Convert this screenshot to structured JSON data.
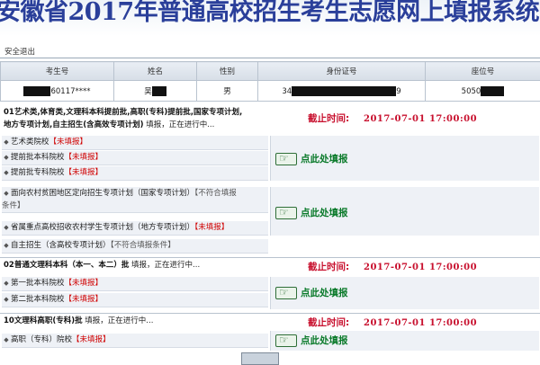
{
  "header": {
    "title": "安徽省2017年普通高校招生考生志愿网上填报系统"
  },
  "toolbar": {
    "logout_label": "安全退出"
  },
  "info_table": {
    "columns": [
      "考生号",
      "姓名",
      "性别",
      "身份证号",
      "座位号"
    ],
    "row": {
      "exam_no": "60117****",
      "name": "吴",
      "gender": "男",
      "id_prefix": "34",
      "id_suffix": "9",
      "seat_prefix": "5050"
    }
  },
  "sections": [
    {
      "title_line1": "01艺术类,体育类,文理科本科提前批,高职(专科)提前批,国家专项计划,",
      "title_line2_bold": "地方专项计划,自主招生(含高效专项计划)",
      "title_status": " 填报，正在进行中...",
      "deadline_label": "截止时间:",
      "deadline_time": "2017-07-01  17:00:00",
      "items": [
        {
          "label": "艺术类院校",
          "status": "【未填报】"
        },
        {
          "label": "提前批本科院校",
          "status": "【未填报】"
        },
        {
          "label": "提前批专科院校",
          "status": "【未填报】"
        },
        {
          "label": "面向农村贫困地区定向招生专项计划（国家专项计划）",
          "status": "【不符合填报",
          "status_wrap": "条件】"
        },
        {
          "label": "省属重点高校招收农村学生专项计划（地方专项计划）",
          "status": "【未填报】"
        },
        {
          "label": "自主招生（含高校专项计划）",
          "status": "【不符合填报条件】"
        }
      ],
      "fill_labels": [
        "点此处填报",
        "点此处填报"
      ]
    },
    {
      "title_bold": "02普通文理科本科（本一、本二）批",
      "title_status": " 填报，正在进行中...",
      "deadline_label": "截止时间:",
      "deadline_time": "2017-07-01  17:00:00",
      "items": [
        {
          "label": "第一批本科院校",
          "status": "【未填报】"
        },
        {
          "label": "第二批本科院校",
          "status": "【未填报】"
        }
      ],
      "fill_label": "点此处填报"
    },
    {
      "title_bold": "10文理科高职(专科)批",
      "title_status": " 填报，正在进行中...",
      "deadline_label": "截止时间:",
      "deadline_time": "2017-07-01  17:00:00",
      "items": [
        {
          "label": "高职（专科）院校",
          "status": "【未填报】"
        }
      ],
      "fill_label": "点此处填报"
    }
  ],
  "colors": {
    "deadline": "#c8102e",
    "not_filled": "#d00000",
    "fill_button": "#0a7a2a",
    "title": "#2a3f9a"
  },
  "icons": [
    "pointing-hand-icon"
  ]
}
